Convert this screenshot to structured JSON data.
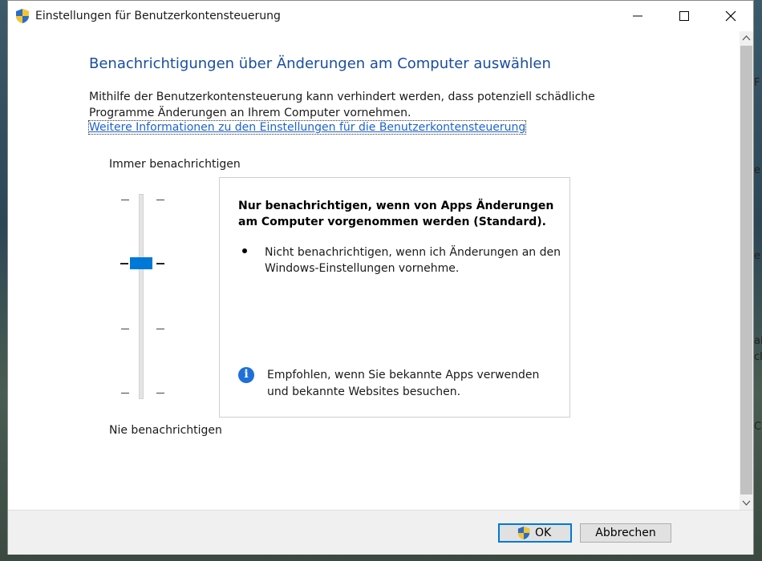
{
  "background": {
    "right_glyphs": [
      "F",
      "e",
      "e",
      "ai",
      "cl",
      "Cl"
    ]
  },
  "window": {
    "title": "Einstellungen für Benutzerkontensteuerung",
    "controls": {
      "minimize_icon": "minimize-icon",
      "maximize_icon": "maximize-icon",
      "close_icon": "close-icon"
    }
  },
  "content": {
    "heading": "Benachrichtigungen über Änderungen am Computer auswählen",
    "description": "Mithilfe der Benutzerkontensteuerung kann verhindert werden, dass potenziell schädliche Programme Änderungen an Ihrem Computer vornehmen.",
    "link": "Weitere Informationen zu den Einstellungen für die Benutzerkontensteuerung"
  },
  "slider": {
    "top_label": "Immer benachrichtigen",
    "bottom_label": "Nie benachrichtigen",
    "levels": 4,
    "selected_level": 3
  },
  "info": {
    "title": "Nur benachrichtigen, wenn von Apps Änderungen am Computer vorgenommen werden (Standard).",
    "bullet": "Nicht benachrichtigen, wenn ich Änderungen an den Windows-Einstellungen vornehme.",
    "recommendation": "Empfohlen, wenn Sie bekannte Apps verwenden und bekannte Websites besuchen.",
    "info_icon": "info-icon"
  },
  "footer": {
    "ok_label": "OK",
    "cancel_label": "Abbrechen"
  },
  "colors": {
    "accent": "#0078d7",
    "heading": "#1a4ea0",
    "link": "#1f63c8"
  }
}
